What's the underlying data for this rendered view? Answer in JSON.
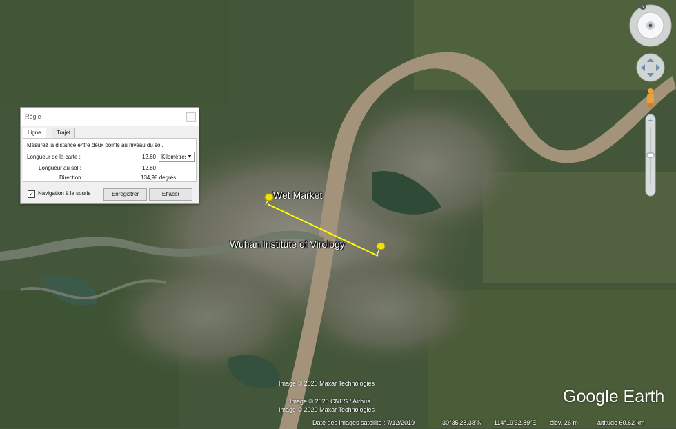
{
  "ruler": {
    "title": "Règle",
    "tabs": [
      "Ligne",
      "Trajet"
    ],
    "description": "Mesurez la distance entre deux points au niveau du sol.",
    "map_length_label": "Longueur de la carte :",
    "map_length_value": "12,60",
    "unit": "Kilomètres",
    "ground_length_label": "Longueur au sol :",
    "ground_length_value": "12,60",
    "heading_label": "Direction :",
    "heading_value": "134,98 degrés",
    "mouse_nav_label": "Navigation à la souris",
    "mouse_nav_checked": true,
    "save_label": "Enregistrer",
    "clear_label": "Effacer"
  },
  "placemarks": {
    "a": "Wet Market",
    "b": "Wuhan Institute of Virology"
  },
  "credits": {
    "line1": "Image © 2020 Maxar Technologies",
    "line2": "Image © 2020 CNES / Airbus",
    "line3": "Image © 2020 Maxar Technologies"
  },
  "brand": "Google Earth",
  "status": {
    "imagery_date": "Date des images satellite : 7/12/2019",
    "latitude": "30°35'28.38\"N",
    "longitude": "114°19'32.89\"E",
    "elevation": "élév.   26 m",
    "eye_alt": "altitude   60.62 km"
  },
  "compass_letter": "N"
}
